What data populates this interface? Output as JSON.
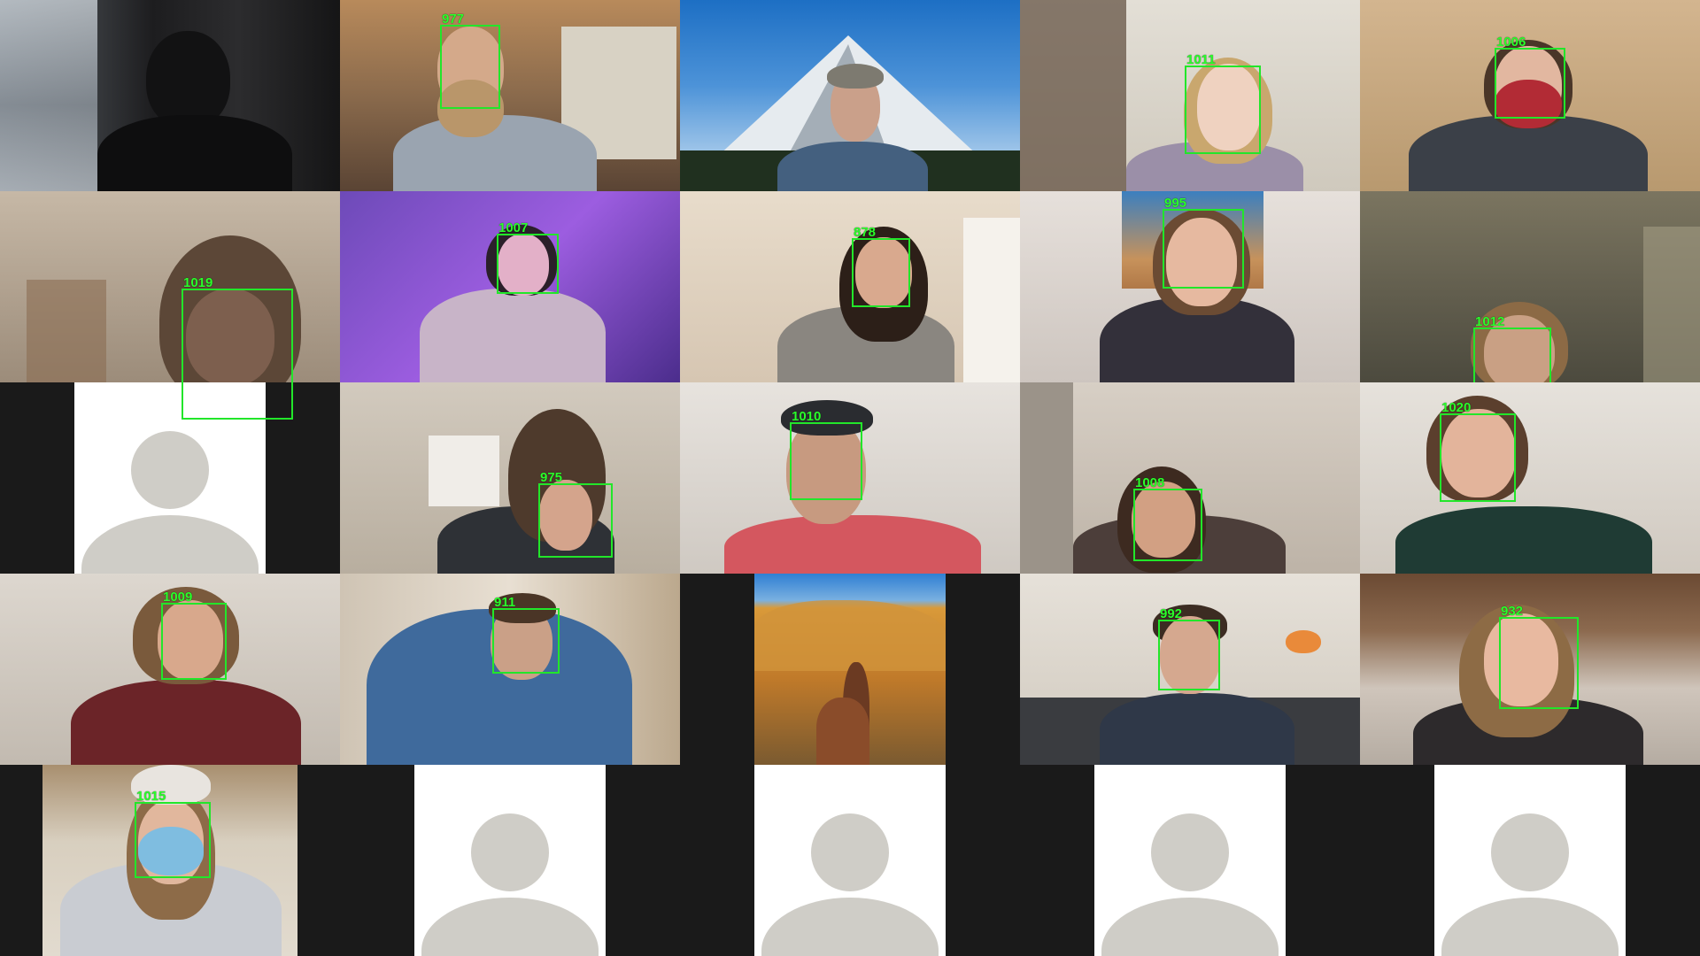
{
  "meeting": {
    "view": "gallery",
    "detection_box_color": "#22e62a",
    "detection_label_color": "#2bff2b",
    "placeholder_color": "#cfcdc7"
  },
  "tiles": [
    {
      "row": 1,
      "col": 1,
      "kind": "video",
      "label": ""
    },
    {
      "row": 1,
      "col": 2,
      "kind": "video",
      "label": "977"
    },
    {
      "row": 1,
      "col": 3,
      "kind": "video",
      "label": ""
    },
    {
      "row": 1,
      "col": 4,
      "kind": "video",
      "label": "1011"
    },
    {
      "row": 1,
      "col": 5,
      "kind": "video",
      "label": "1006"
    },
    {
      "row": 2,
      "col": 1,
      "kind": "video",
      "label": "1019"
    },
    {
      "row": 2,
      "col": 2,
      "kind": "video",
      "label": "1007"
    },
    {
      "row": 2,
      "col": 3,
      "kind": "video",
      "label": "878"
    },
    {
      "row": 2,
      "col": 4,
      "kind": "video",
      "label": "995"
    },
    {
      "row": 2,
      "col": 5,
      "kind": "video",
      "label": "1012"
    },
    {
      "row": 3,
      "col": 1,
      "kind": "avatar",
      "label": ""
    },
    {
      "row": 3,
      "col": 2,
      "kind": "video",
      "label": "975"
    },
    {
      "row": 3,
      "col": 3,
      "kind": "video",
      "label": "1010"
    },
    {
      "row": 3,
      "col": 4,
      "kind": "video",
      "label": "1008"
    },
    {
      "row": 3,
      "col": 5,
      "kind": "video",
      "label": "1020"
    },
    {
      "row": 4,
      "col": 1,
      "kind": "video",
      "label": "1009"
    },
    {
      "row": 4,
      "col": 2,
      "kind": "video",
      "label": "911"
    },
    {
      "row": 4,
      "col": 3,
      "kind": "video",
      "label": ""
    },
    {
      "row": 4,
      "col": 4,
      "kind": "video",
      "label": "992"
    },
    {
      "row": 4,
      "col": 5,
      "kind": "video",
      "label": "932"
    },
    {
      "row": 5,
      "col": 1,
      "kind": "video",
      "label": "1015"
    },
    {
      "row": 5,
      "col": 2,
      "kind": "avatar",
      "label": ""
    },
    {
      "row": 5,
      "col": 3,
      "kind": "avatar",
      "label": ""
    },
    {
      "row": 5,
      "col": 4,
      "kind": "avatar",
      "label": ""
    },
    {
      "row": 5,
      "col": 5,
      "kind": "avatar",
      "label": ""
    }
  ]
}
